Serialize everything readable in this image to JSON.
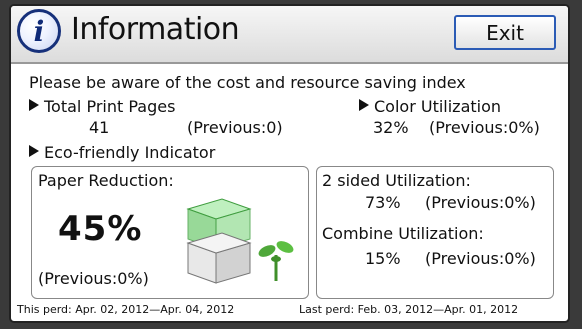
{
  "window": {
    "title": "Information",
    "exit_label": "Exit"
  },
  "intro": "Please be aware of the cost and resource saving index",
  "total_print_pages": {
    "label": "Total Print Pages",
    "value": "41",
    "previous": "(Previous:0)"
  },
  "color_utilization": {
    "label": "Color Utilization",
    "value": "32%",
    "previous": "(Previous:0%)"
  },
  "eco_indicator": {
    "label": "Eco-friendly Indicator"
  },
  "paper_reduction": {
    "label": "Paper Reduction:",
    "value": "45%",
    "previous": "(Previous:0%)"
  },
  "two_sided": {
    "label": "2 sided Utilization:",
    "value": "73%",
    "previous": "(Previous:0%)"
  },
  "combine": {
    "label": "Combine Utilization:",
    "value": "15%",
    "previous": "(Previous:0%)"
  },
  "footer": {
    "this_period": "This perd: Apr. 02, 2012—Apr. 04, 2012",
    "last_period": "Last perd: Feb. 03, 2012—Apr. 01, 2012"
  },
  "icons": [
    "info-icon",
    "paper-stack-icon",
    "sprout-icon"
  ],
  "colors": {
    "accent": "#2b5bb5",
    "info_icon": "#16307a",
    "paper_green": "#7fd07f",
    "sprout_green": "#3f8f2a"
  }
}
